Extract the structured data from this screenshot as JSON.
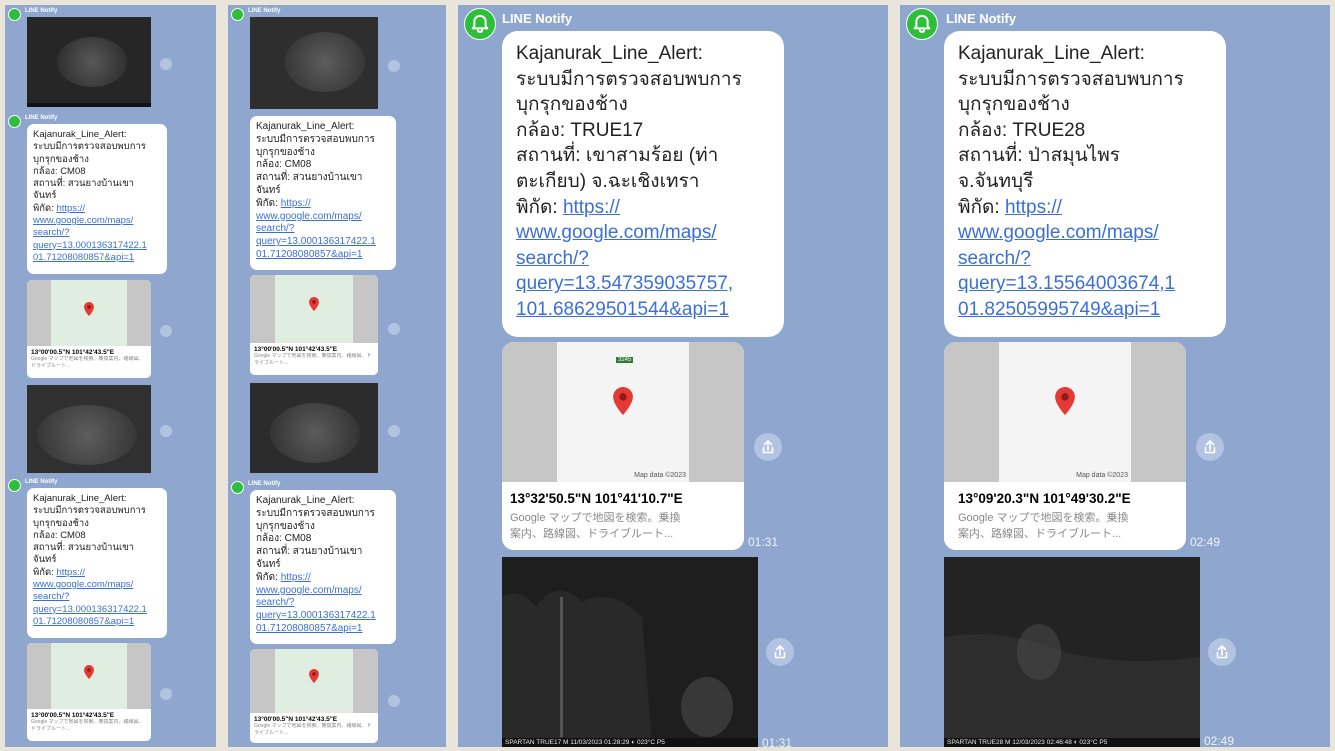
{
  "app": {
    "sender": "LINE Notify"
  },
  "panels": [
    {
      "msg1": {
        "lines": [
          "Kajanurak_Line_Alert:",
          "ระบบมีการตรวจสอบพบการ",
          "บุกรุกของช้าง",
          "กล้อง: CM08",
          "สถานที่: สวนยางบ้านเขา",
          "จันทร์"
        ],
        "coord_label": "พิกัด: ",
        "link_lines": [
          "https://",
          "www.google.com/maps/",
          "search/?",
          "query=13.000136317422.1",
          "01.71208080857&api=1"
        ]
      },
      "msg2": {
        "lines": [
          "Kajanurak_Line_Alert:",
          "ระบบมีการตรวจสอบพบการ",
          "บุกรุกของช้าง",
          "กล้อง: CM08",
          "สถานที่: สวนยางบ้านเขา",
          "จันทร์"
        ],
        "coord_label": "พิกัด: ",
        "link_lines": [
          "https://",
          "www.google.com/maps/",
          "search/?",
          "query=13.000136317422.1",
          "01.71208080857&api=1"
        ]
      },
      "map": {
        "title": "13°00'00.5\"N 101°42'43.5\"E",
        "desc": "Google マップで地図を検索。乗換案内、路線図、ドライブルート..."
      }
    },
    {
      "msg1": {
        "lines": [
          "Kajanurak_Line_Alert:",
          "ระบบมีการตรวจสอบพบการ",
          "บุกรุกของช้าง",
          "กล้อง: CM08",
          "สถานที่: สวนยางบ้านเขา",
          "จันทร์"
        ],
        "coord_label": "พิกัด: ",
        "link_lines": [
          "https://",
          "www.google.com/maps/",
          "search/?",
          "query=13.000136317422.1",
          "01.71208080857&api=1"
        ]
      },
      "msg2": {
        "lines": [
          "Kajanurak_Line_Alert:",
          "ระบบมีการตรวจสอบพบการ",
          "บุกรุกของช้าง",
          "กล้อง: CM08",
          "สถานที่: สวนยางบ้านเขา",
          "จันทร์"
        ],
        "coord_label": "พิกัด: ",
        "link_lines": [
          "https://",
          "www.google.com/maps/",
          "search/?",
          "query=13.000136317422.1",
          "01.71208080857&api=1"
        ]
      },
      "map": {
        "title": "13°00'00.5\"N 101°42'43.5\"E",
        "desc": "Google マップで地図を検索。乗換案内、路線図、ドライブルート..."
      }
    },
    {
      "msg": {
        "lines": [
          "Kajanurak_Line_Alert:",
          "ระบบมีการตรวจสอบพบการ",
          "บุกรุกของช้าง",
          "กล้อง: TRUE17",
          "สถานที่: เขาสามร้อย (ท่า",
          "ตะเกียบ)  จ.ฉะเชิงเทรา"
        ],
        "coord_label": "พิกัด: ",
        "link_lines": [
          "https://",
          "www.google.com/maps/",
          "search/?",
          "query=13.547359035757,",
          "101.68629501544&api=1"
        ]
      },
      "map": {
        "title": "13°32'50.5\"N 101°41'10.7\"E",
        "desc1": "Google マップで地図を検索。乗換",
        "desc2": "案内、路線図、ドライブルート...",
        "attribution": "Map data ©2023",
        "road_badge": "3245"
      },
      "time1": "01:31",
      "time2": "01:31",
      "cam_bar": "SPARTAN    TRUE17    M    11/03/2023 01:28:29    ◐ 023°C    P5"
    },
    {
      "msg": {
        "lines": [
          "Kajanurak_Line_Alert:",
          "ระบบมีการตรวจสอบพบการ",
          "บุกรุกของช้าง",
          "กล้อง: TRUE28",
          "สถานที่: ป่าสมุนไพร",
          "จ.จันทบุรี"
        ],
        "coord_label": "พิกัด: ",
        "link_lines": [
          "https://",
          "www.google.com/maps/",
          "search/?",
          "query=13.15564003674,1",
          "01.82505995749&api=1"
        ]
      },
      "map": {
        "title": "13°09'20.3\"N 101°49'30.2\"E",
        "desc1": "Google マップで地図を検索。乗換",
        "desc2": "案内、路線図、ドライブルート...",
        "attribution": "Map data ©2023"
      },
      "time1": "02:49",
      "time2": "02:49",
      "cam_bar": "SPARTAN    TRUE28    M    12/03/2023 02:46:48    ◐ 023°C    P5"
    }
  ],
  "icons": [
    "bell-icon",
    "share-icon",
    "map-pin-icon"
  ],
  "colors": {
    "panel_bg": "#8fa7cf",
    "link": "#3b6fd8",
    "avatar_green": "#2dbf3a",
    "pin_red": "#e53935",
    "page_bg": "#e9e5da"
  }
}
